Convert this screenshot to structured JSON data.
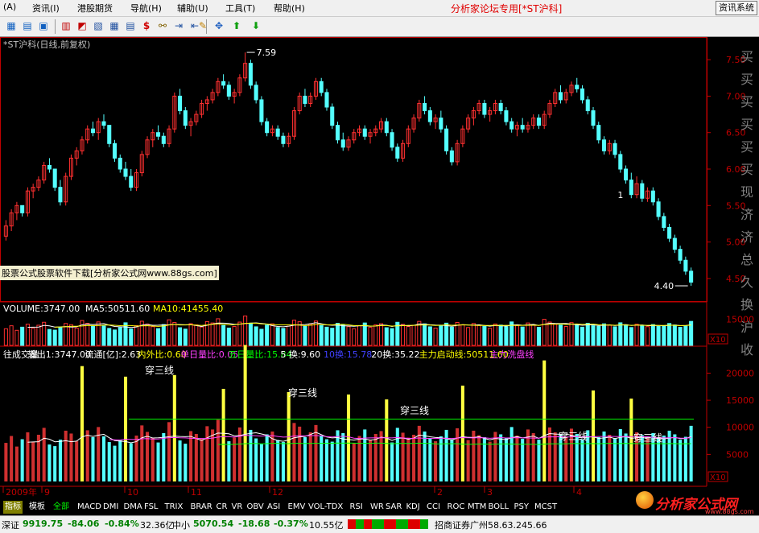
{
  "menu": {
    "items": [
      "(A)",
      "资讯(I)",
      "港股期货",
      "导航(H)",
      "辅助(U)",
      "工具(T)",
      "帮助(H)"
    ],
    "title": "分析家论坛专用[*ST沪科]",
    "right_button": "资讯系统"
  },
  "chart_header": "*ST沪科(日线,前复权)",
  "watermark": "股票公式股票软件下载[分析家公式网www.88gs.com]",
  "price_axis": {
    "ticks": [
      "7.50",
      "7.00",
      "6.50",
      "6.00",
      "5.50",
      "5.00",
      "4.50"
    ]
  },
  "price_annot": {
    "high": "7.59",
    "low": "4.40",
    "mark": "1"
  },
  "volume_header": {
    "label": "VOLUME:3747.00",
    "ma5": "MA5:50511.60",
    "ma10": "MA10:41455.40"
  },
  "volume_axis": {
    "ticks": [
      "15000",
      "X10"
    ]
  },
  "indicator_header": {
    "name": "往成交量",
    "output": "输出1:3747.00",
    "float": "流通[亿]:2.63",
    "inout": "内外比:0.60",
    "d1": "单日量比:0.05",
    "d5": "五日量比:15.84",
    "h5": "5 换:9.60",
    "h10": "10换:15.78",
    "h20": "20换:35.22",
    "main": "主力启动线:50511.60",
    "wash": "主力洗盘线"
  },
  "indicator_axis": {
    "ticks": [
      "20000",
      "15000",
      "10000",
      "5000",
      "X10"
    ]
  },
  "labels": [
    "穿三线",
    "穿三线",
    "穿三线",
    "穿三线",
    "穿三线"
  ],
  "side_text": [
    "买",
    "买",
    "买",
    "买",
    "买",
    "买",
    "现",
    "济",
    "济",
    "总",
    "久",
    "换",
    "沪",
    "收"
  ],
  "date_axis": [
    "2009年",
    "9",
    "10",
    "11",
    "12",
    "2",
    "3",
    "4"
  ],
  "tabs": [
    "指标",
    "模板",
    "全部",
    "MACD",
    "DMI",
    "DMA",
    "FSL",
    "TRIX",
    "BRAR",
    "CR",
    "VR",
    "OBV",
    "ASI",
    "EMV",
    "VOL-TDX",
    "RSI",
    "WR",
    "SAR",
    "KDJ",
    "CCI",
    "ROC",
    "MTM",
    "BOLL",
    "PSY",
    "MCST"
  ],
  "status": {
    "sz_label": "深证",
    "sz_value": "9919.75",
    "sz_change": "-84.06",
    "sz_pct": "-0.84%",
    "sz_amount": "32.36亿",
    "zx_label": "中小",
    "zx_value": "5070.54",
    "zx_change": "-18.68",
    "zx_pct": "-0.37%",
    "zx_amount": "10.55亿",
    "broker": "招商证券广州58.63.245.66"
  },
  "logo": "分析家公式网",
  "logo_url": "www.88gs.com",
  "colors": {
    "up": "#ff3030",
    "down": "#54ffff",
    "ma5": "#ffffff",
    "ma10": "#ffff00",
    "ma20": "#ff40ff",
    "ma_long": "#00ff00",
    "axis": "#c00000"
  },
  "chart_data": {
    "type": "candlestick",
    "ylim": [
      4.3,
      7.7
    ],
    "ohlc": [
      [
        5.08,
        5.3,
        5.02,
        5.22
      ],
      [
        5.22,
        5.45,
        5.15,
        5.4
      ],
      [
        5.4,
        5.55,
        5.3,
        5.5
      ],
      [
        5.5,
        5.48,
        5.35,
        5.4
      ],
      [
        5.4,
        5.75,
        5.35,
        5.7
      ],
      [
        5.7,
        5.8,
        5.6,
        5.75
      ],
      [
        5.75,
        5.9,
        5.7,
        5.85
      ],
      [
        5.85,
        6.1,
        5.8,
        6.05
      ],
      [
        6.05,
        6.15,
        5.95,
        6.0
      ],
      [
        6.0,
        6.0,
        5.7,
        5.75
      ],
      [
        5.75,
        5.85,
        5.5,
        5.55
      ],
      [
        5.55,
        5.95,
        5.5,
        5.9
      ],
      [
        5.9,
        6.2,
        5.85,
        6.15
      ],
      [
        6.15,
        6.3,
        6.05,
        6.25
      ],
      [
        6.25,
        6.45,
        6.2,
        6.4
      ],
      [
        6.4,
        6.6,
        6.35,
        6.55
      ],
      [
        6.55,
        6.65,
        6.45,
        6.5
      ],
      [
        6.5,
        6.7,
        6.4,
        6.65
      ],
      [
        6.65,
        6.75,
        6.55,
        6.6
      ],
      [
        6.6,
        6.6,
        6.3,
        6.35
      ],
      [
        6.35,
        6.4,
        6.1,
        6.15
      ],
      [
        6.15,
        6.2,
        5.95,
        6.0
      ],
      [
        6.0,
        6.1,
        5.85,
        5.9
      ],
      [
        5.9,
        6.0,
        5.7,
        5.75
      ],
      [
        5.75,
        6.0,
        5.7,
        5.95
      ],
      [
        5.95,
        6.25,
        5.9,
        6.2
      ],
      [
        6.2,
        6.45,
        6.15,
        6.4
      ],
      [
        6.4,
        6.55,
        6.3,
        6.5
      ],
      [
        6.5,
        6.6,
        6.4,
        6.45
      ],
      [
        6.45,
        6.5,
        6.3,
        6.35
      ],
      [
        6.35,
        6.6,
        6.3,
        6.55
      ],
      [
        6.55,
        7.05,
        6.5,
        7.0
      ],
      [
        7.0,
        7.1,
        6.75,
        6.8
      ],
      [
        6.8,
        6.85,
        6.55,
        6.6
      ],
      [
        6.6,
        6.7,
        6.45,
        6.65
      ],
      [
        6.65,
        6.8,
        6.6,
        6.75
      ],
      [
        6.75,
        6.95,
        6.7,
        6.9
      ],
      [
        6.9,
        7.0,
        6.8,
        6.95
      ],
      [
        6.95,
        7.1,
        6.9,
        7.05
      ],
      [
        7.05,
        7.25,
        7.0,
        7.2
      ],
      [
        7.2,
        7.3,
        7.1,
        7.15
      ],
      [
        7.15,
        7.2,
        6.95,
        7.0
      ],
      [
        7.0,
        7.1,
        6.9,
        7.05
      ],
      [
        7.05,
        7.3,
        7.0,
        7.25
      ],
      [
        7.25,
        7.6,
        7.2,
        7.45
      ],
      [
        7.45,
        7.5,
        7.1,
        7.15
      ],
      [
        7.15,
        7.2,
        6.9,
        6.95
      ],
      [
        6.95,
        7.0,
        6.6,
        6.65
      ],
      [
        6.65,
        6.7,
        6.45,
        6.5
      ],
      [
        6.5,
        6.6,
        6.45,
        6.55
      ],
      [
        6.55,
        6.6,
        6.4,
        6.45
      ],
      [
        6.45,
        6.5,
        6.3,
        6.35
      ],
      [
        6.35,
        6.5,
        6.3,
        6.45
      ],
      [
        6.45,
        6.85,
        6.4,
        6.8
      ],
      [
        6.8,
        7.05,
        6.75,
        7.0
      ],
      [
        7.0,
        7.1,
        6.85,
        6.9
      ],
      [
        6.9,
        7.05,
        6.85,
        7.0
      ],
      [
        7.0,
        7.25,
        6.95,
        7.2
      ],
      [
        7.2,
        7.25,
        7.0,
        7.05
      ],
      [
        7.05,
        7.1,
        6.8,
        6.85
      ],
      [
        6.85,
        6.9,
        6.55,
        6.6
      ],
      [
        6.6,
        6.65,
        6.35,
        6.4
      ],
      [
        6.4,
        6.5,
        6.25,
        6.3
      ],
      [
        6.3,
        6.45,
        6.25,
        6.4
      ],
      [
        6.4,
        6.55,
        6.35,
        6.5
      ],
      [
        6.5,
        6.6,
        6.45,
        6.55
      ],
      [
        6.55,
        6.6,
        6.4,
        6.45
      ],
      [
        6.45,
        6.55,
        6.35,
        6.5
      ],
      [
        6.5,
        6.6,
        6.45,
        6.55
      ],
      [
        6.55,
        6.7,
        6.5,
        6.65
      ],
      [
        6.65,
        6.7,
        6.45,
        6.5
      ],
      [
        6.5,
        6.55,
        6.25,
        6.3
      ],
      [
        6.3,
        6.35,
        6.1,
        6.15
      ],
      [
        6.15,
        6.4,
        6.1,
        6.35
      ],
      [
        6.35,
        6.6,
        6.3,
        6.55
      ],
      [
        6.55,
        6.75,
        6.5,
        6.7
      ],
      [
        6.7,
        6.95,
        6.65,
        6.9
      ],
      [
        6.9,
        7.0,
        6.75,
        6.8
      ],
      [
        6.8,
        6.85,
        6.6,
        6.65
      ],
      [
        6.65,
        6.75,
        6.55,
        6.7
      ],
      [
        6.7,
        6.8,
        6.5,
        6.55
      ],
      [
        6.55,
        6.6,
        6.2,
        6.25
      ],
      [
        6.25,
        6.3,
        6.05,
        6.1
      ],
      [
        6.1,
        6.4,
        6.05,
        6.35
      ],
      [
        6.35,
        6.6,
        6.3,
        6.55
      ],
      [
        6.55,
        6.75,
        6.5,
        6.7
      ],
      [
        6.7,
        6.85,
        6.6,
        6.8
      ],
      [
        6.8,
        6.95,
        6.75,
        6.9
      ],
      [
        6.9,
        6.95,
        6.7,
        6.75
      ],
      [
        6.75,
        6.85,
        6.65,
        6.8
      ],
      [
        6.8,
        6.95,
        6.75,
        6.9
      ],
      [
        6.9,
        6.95,
        6.75,
        6.8
      ],
      [
        6.8,
        6.85,
        6.6,
        6.65
      ],
      [
        6.65,
        6.7,
        6.5,
        6.55
      ],
      [
        6.55,
        6.65,
        6.45,
        6.6
      ],
      [
        6.6,
        6.7,
        6.5,
        6.55
      ],
      [
        6.55,
        6.65,
        6.5,
        6.6
      ],
      [
        6.6,
        6.75,
        6.55,
        6.7
      ],
      [
        6.7,
        6.75,
        6.55,
        6.6
      ],
      [
        6.6,
        6.8,
        6.55,
        6.75
      ],
      [
        6.75,
        6.95,
        6.7,
        6.9
      ],
      [
        6.9,
        7.1,
        6.85,
        7.05
      ],
      [
        7.05,
        7.15,
        6.9,
        6.95
      ],
      [
        6.95,
        7.1,
        6.9,
        7.05
      ],
      [
        7.05,
        7.2,
        7.0,
        7.15
      ],
      [
        7.15,
        7.25,
        7.05,
        7.1
      ],
      [
        7.1,
        7.15,
        6.9,
        6.95
      ],
      [
        6.95,
        7.0,
        6.75,
        6.8
      ],
      [
        6.8,
        6.85,
        6.55,
        6.6
      ],
      [
        6.6,
        6.65,
        6.35,
        6.4
      ],
      [
        6.4,
        6.45,
        6.2,
        6.25
      ],
      [
        6.25,
        6.4,
        6.2,
        6.35
      ],
      [
        6.35,
        6.4,
        6.15,
        6.2
      ],
      [
        6.2,
        6.25,
        5.95,
        6.0
      ],
      [
        6.0,
        6.05,
        5.8,
        5.85
      ],
      [
        5.85,
        5.95,
        5.6,
        5.65
      ],
      [
        5.65,
        5.9,
        5.6,
        5.8
      ],
      [
        5.8,
        5.85,
        5.55,
        5.6
      ],
      [
        5.6,
        5.75,
        5.55,
        5.7
      ],
      [
        5.7,
        5.75,
        5.5,
        5.55
      ],
      [
        5.55,
        5.6,
        5.3,
        5.35
      ],
      [
        5.35,
        5.4,
        5.15,
        5.2
      ],
      [
        5.2,
        5.25,
        5.0,
        5.05
      ],
      [
        5.05,
        5.1,
        4.85,
        4.9
      ],
      [
        4.9,
        4.95,
        4.7,
        4.75
      ],
      [
        4.75,
        4.8,
        4.55,
        4.6
      ],
      [
        4.6,
        4.65,
        4.4,
        4.45
      ]
    ],
    "volume": [
      9500,
      11200,
      8600,
      10400,
      12100,
      9800,
      11500,
      13200,
      9100,
      8700,
      10300,
      12500,
      11800,
      9900,
      14200,
      12600,
      10900,
      13400,
      11100,
      9700,
      8800,
      10200,
      12900,
      9400,
      11300,
      13800,
      12200,
      10700,
      9600,
      11900,
      14600,
      13100,
      10100,
      9300,
      12400,
      11700,
      10500,
      13600,
      12800,
      15200,
      11400,
      9900,
      10800,
      13300,
      16800,
      12700,
      10600,
      9200,
      11600,
      12300,
      10200,
      9700,
      11000,
      14400,
      13500,
      10900,
      12100,
      13900,
      11300,
      10400,
      9800,
      12600,
      11900,
      10700,
      9500,
      11200,
      12800,
      10300,
      11700,
      12400,
      10100,
      9600,
      13200,
      12000,
      10800,
      11500,
      13700,
      12300,
      10600,
      9900,
      11100,
      12700,
      10400,
      13100,
      11800,
      10200,
      12500,
      11400,
      10900,
      9800,
      12200,
      11600,
      10700,
      13400,
      11300,
      10500,
      12800,
      11900,
      10300,
      14900,
      13300,
      12100,
      11600,
      10800,
      13000,
      11700,
      10400,
      12600,
      11200,
      10900,
      12300,
      11500,
      10600,
      12900,
      11800,
      10200,
      12100,
      11400,
      10700,
      11900,
      10800,
      11300,
      12500,
      11600,
      10300,
      11000,
      13700
    ]
  }
}
